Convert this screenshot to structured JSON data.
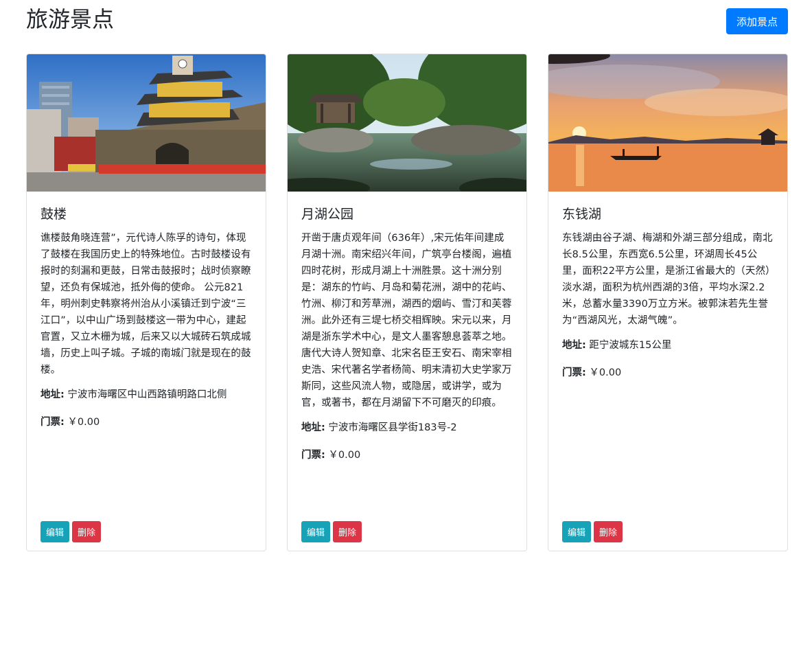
{
  "header": {
    "title": "旅游景点",
    "add_label": "添加景点"
  },
  "labels": {
    "address": "地址:",
    "ticket": "门票:",
    "edit": "编辑",
    "delete": "删除"
  },
  "spots": [
    {
      "name": "鼓楼",
      "description": "谯楼鼓角晓连营”，元代诗人陈孚的诗句，体现了鼓楼在我国历史上的特殊地位。古时鼓楼设有报时的刻漏和更鼓，日常击鼓报时；战时侦察瞭望，还负有保城池，抵外侮的使命。 公元821年，明州刺史韩察将州治从小溪镇迁到宁波“三江口”，以中山广场到鼓楼这一带为中心，建起官置，又立木栅为城，后来又以大城砖石筑成城墙，历史上叫子城。子城的南城门就是现在的鼓楼。",
      "address": "宁波市海曙区中山西路镇明路口北侧",
      "ticket": "￥0.00"
    },
    {
      "name": "月湖公园",
      "description": "开凿于唐贞观年间（636年）,宋元佑年间建成月湖十洲。南宋绍兴年间，广筑亭台楼阁，遍植四时花树，形成月湖上十洲胜景。这十洲分别是：湖东的竹屿、月岛和菊花洲，湖中的花屿、竹洲、柳汀和芳草洲，湖西的烟屿、雪汀和芙蓉洲。此外还有三堤七桥交相辉映。宋元以来，月湖是浙东学术中心，是文人墨客憩息荟萃之地。唐代大诗人贺知章、北宋名臣王安石、南宋宰相史浩、宋代著名学者杨简、明末清初大史学家万斯同，这些风流人物，或隐居，或讲学，或为官，或著书，都在月湖留下不可磨灭的印痕。",
      "address": "宁波市海曙区县学街183号-2",
      "ticket": "￥0.00"
    },
    {
      "name": "东钱湖",
      "description": "东钱湖由谷子湖、梅湖和外湖三部分组成，南北长8.5公里，东西宽6.5公里，环湖周长45公里，面积22平方公里，是浙江省最大的（天然）淡水湖，面积为杭州西湖的3倍，平均水深2.2米，总蓄水量3390万立方米。被郭沫若先生誉为“西湖风光，太湖气魄”。",
      "address": "距宁波城东15公里",
      "ticket": "￥0.00"
    }
  ],
  "colors": {
    "primary": "#007bff",
    "info": "#17a2b8",
    "danger": "#dc3545"
  }
}
